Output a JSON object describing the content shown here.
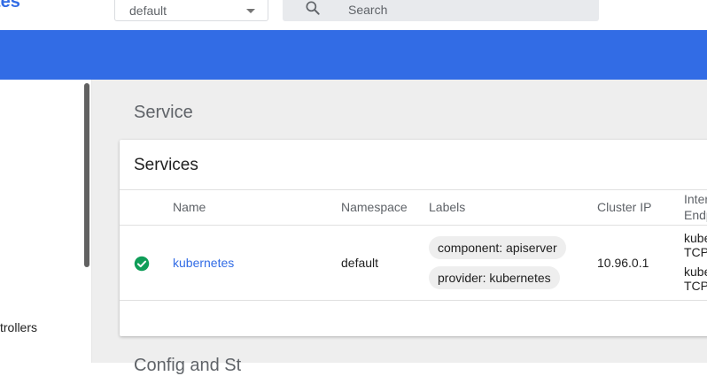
{
  "header": {
    "brand_partial": "tes",
    "namespace_value": "default",
    "search_placeholder": "Search"
  },
  "sidebar": {
    "visible_item": "trollers"
  },
  "main": {
    "page_title": "Service",
    "card_title": "Services",
    "columns": [
      "Name",
      "Namespace",
      "Labels",
      "Cluster IP",
      "Inter",
      "Endp"
    ],
    "row": {
      "status": "ok",
      "name": "kubernetes",
      "namespace": "default",
      "labels": [
        "component: apiserver",
        "provider: kubernetes"
      ],
      "cluster_ip": "10.96.0.1",
      "endpoint_lines": [
        "kube",
        "TCP",
        "kube",
        "TCP"
      ]
    },
    "next_section_partial": "Config and St"
  },
  "colors": {
    "accent": "#326ce5",
    "status_ok": "#0f9d58",
    "chip_bg": "#eeeeee",
    "page_bg": "#eeeeee"
  },
  "icons": {
    "search": "search-icon",
    "dropdown": "chevron-down-icon",
    "status": "check-circle-icon"
  }
}
